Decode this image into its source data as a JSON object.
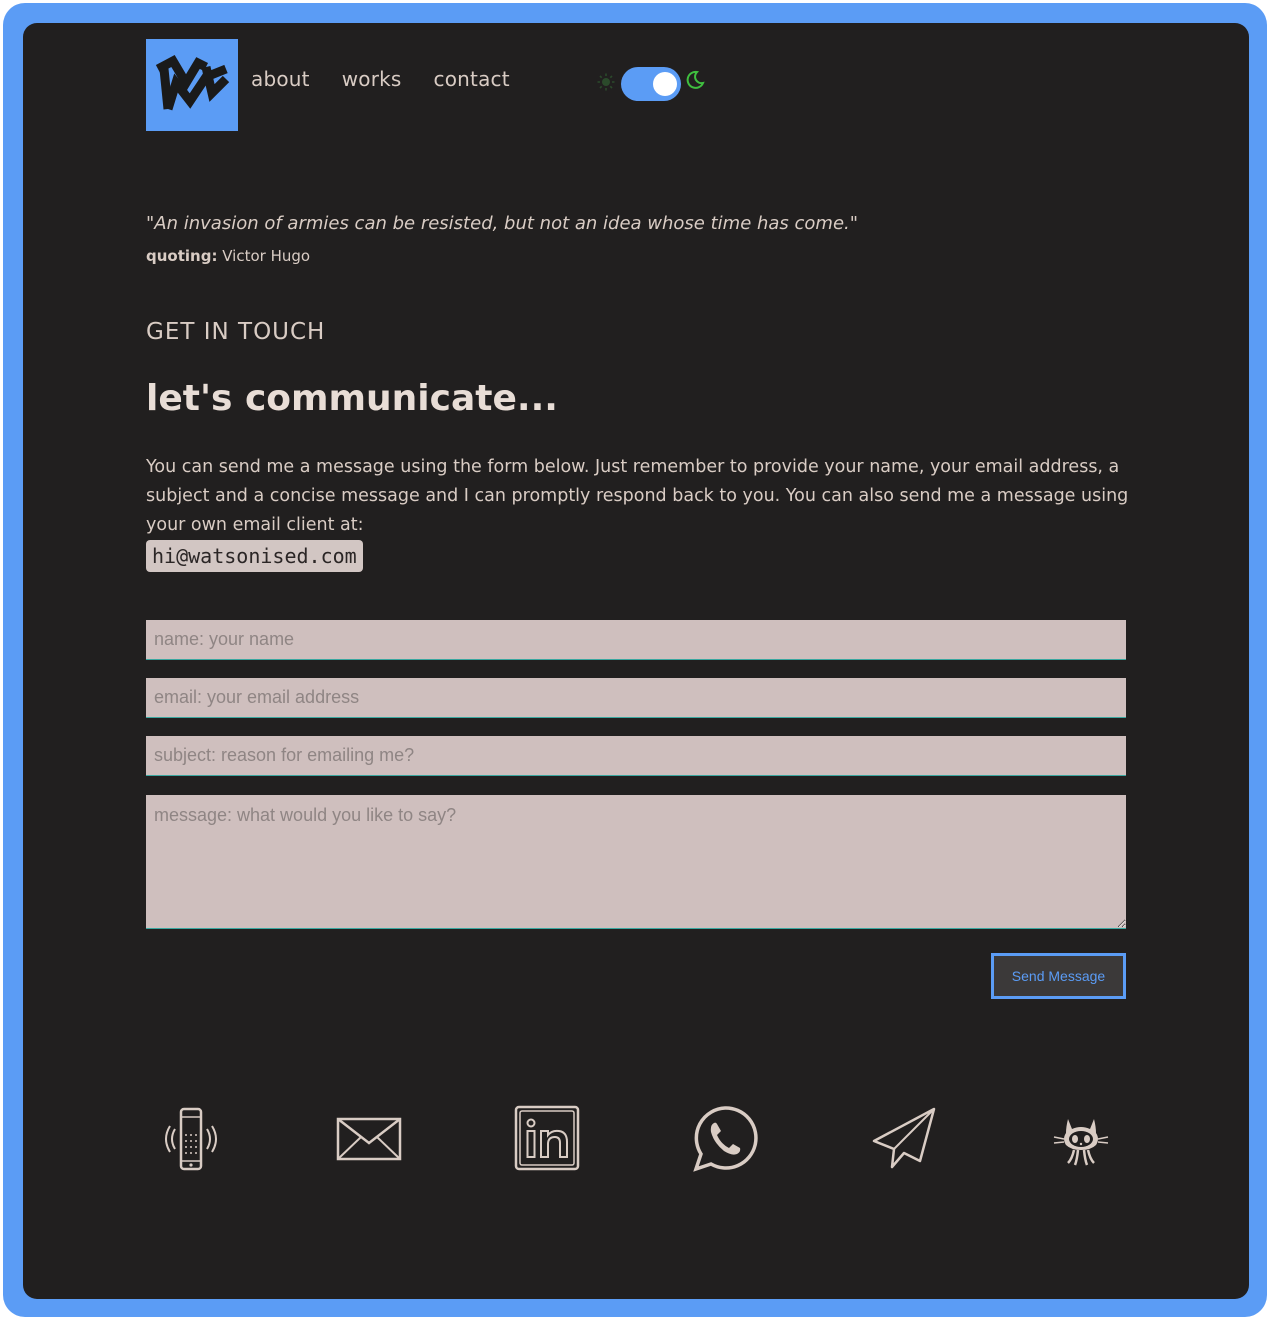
{
  "brand": {
    "logo_alt": "MW",
    "accent": "#5b9cf5",
    "background": "#211f1f"
  },
  "nav": {
    "items": [
      {
        "label": "about"
      },
      {
        "label": "works"
      },
      {
        "label": "contact"
      }
    ]
  },
  "theme_toggle": {
    "state": "dark",
    "icons": [
      "sun-icon",
      "moon-icon"
    ]
  },
  "quote": {
    "text": "\"An invasion of armies can be resisted, but not an idea whose time has come.\"",
    "label": "quoting:",
    "author": "Victor Hugo"
  },
  "contact": {
    "section_label": "GET IN TOUCH",
    "heading": "let's communicate...",
    "description": "You can send me a message using the form below. Just remember to provide your name, your email address, a subject and a concise message and I can promptly respond back to you. You can also send me a message using your own email client at:",
    "email": "hi@watsonised.com"
  },
  "form": {
    "name_placeholder": "name: your name",
    "email_placeholder": "email: your email address",
    "subject_placeholder": "subject: reason for emailing me?",
    "message_placeholder": "message: what would you like to say?",
    "send_label": "Send Message"
  },
  "socials": [
    {
      "icon": "phone-icon"
    },
    {
      "icon": "mail-icon"
    },
    {
      "icon": "linkedin-icon"
    },
    {
      "icon": "whatsapp-icon"
    },
    {
      "icon": "telegram-icon"
    },
    {
      "icon": "github-icon"
    }
  ]
}
